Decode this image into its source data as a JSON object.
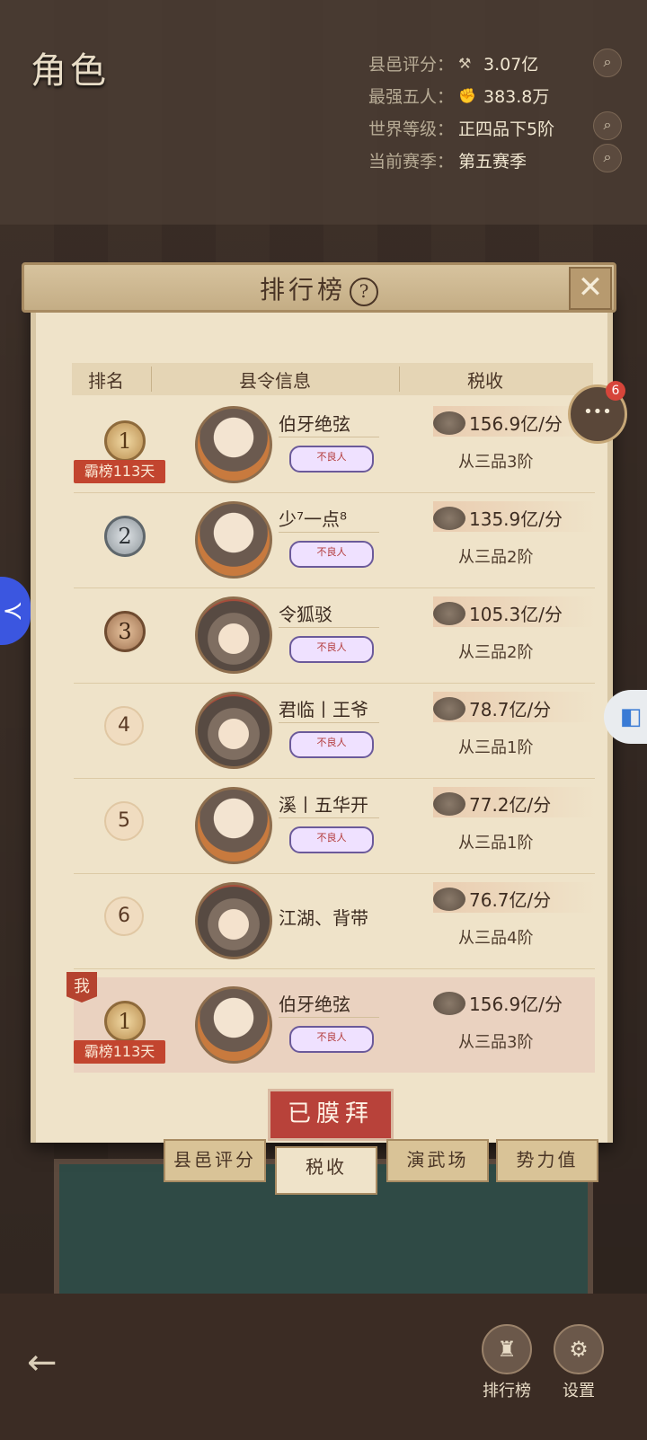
{
  "header": {
    "role_title": "角色",
    "stats": [
      {
        "key": "县邑评分：",
        "icon": "hammer-icon",
        "value": "3.07亿",
        "has_search": true
      },
      {
        "key": "最强五人：",
        "icon": "fist-icon",
        "value": "383.8万",
        "has_search": false
      },
      {
        "key": "世界等级：",
        "icon": "",
        "value": "正四品下5阶",
        "has_search": true
      },
      {
        "key": "当前赛季：",
        "icon": "",
        "value": "第五赛季",
        "has_search": true
      }
    ]
  },
  "panel": {
    "title": "排行榜",
    "help_glyph": "?",
    "close_glyph": "✕",
    "columns": [
      "排名",
      "县令信息",
      "税收"
    ],
    "rows": [
      {
        "rank": "1",
        "medal": "gold",
        "streak": "霸榜113天",
        "name": "伯牙绝弦",
        "badge": "不良人",
        "tax": "156.9亿/分",
        "grade": "从三品3阶",
        "avatar": "scholar"
      },
      {
        "rank": "2",
        "medal": "silver",
        "streak": "",
        "name": "少⁷一点⁸",
        "badge": "不良人",
        "tax": "135.9亿/分",
        "grade": "从三品2阶",
        "avatar": "scholar"
      },
      {
        "rank": "3",
        "medal": "bronze",
        "streak": "",
        "name": "令狐驳",
        "badge": "不良人",
        "tax": "105.3亿/分",
        "grade": "从三品2阶",
        "avatar": "hat"
      },
      {
        "rank": "4",
        "medal": "plain",
        "streak": "",
        "name": "君临丨王爷",
        "badge": "不良人",
        "tax": "78.7亿/分",
        "grade": "从三品1阶",
        "avatar": "hat"
      },
      {
        "rank": "5",
        "medal": "plain",
        "streak": "",
        "name": "溪丨五华开",
        "badge": "不良人",
        "tax": "77.2亿/分",
        "grade": "从三品1阶",
        "avatar": "scholar"
      },
      {
        "rank": "6",
        "medal": "plain",
        "streak": "",
        "name": "江湖、背带",
        "badge": "不良人",
        "tax": "76.7亿/分",
        "grade": "从三品4阶",
        "avatar": "hat"
      }
    ],
    "me": {
      "tag": "我",
      "rank": "1",
      "streak": "霸榜113天",
      "name": "伯牙绝弦",
      "badge": "不良人",
      "tax": "156.9亿/分",
      "grade": "从三品3阶"
    },
    "worship_button": "已膜拜",
    "tabs": [
      "县邑评分",
      "税收",
      "演武场",
      "势力值"
    ],
    "active_tab": "税收"
  },
  "side": {
    "chat_badge": "6"
  },
  "bottom": {
    "ranking_label": "排行榜",
    "settings_label": "设置"
  },
  "colors": {
    "accent_red": "#b8423a",
    "paper": "#efe3c9",
    "badge_red": "#c2452f"
  }
}
